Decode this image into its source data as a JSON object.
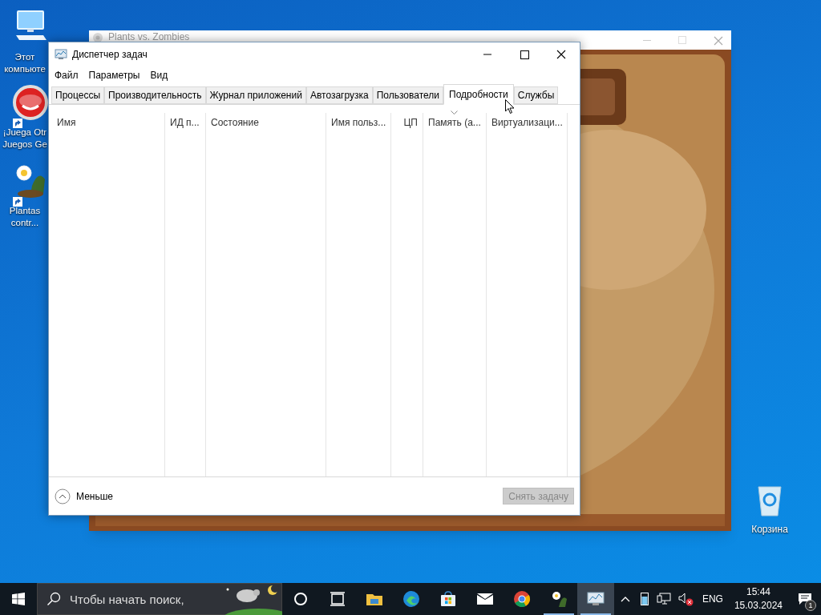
{
  "desktop_icons": [
    {
      "kind": "computer",
      "label": "Этот компьюте",
      "shortcut": false
    },
    {
      "kind": "popcap",
      "label": "¡Juega Otr Juegos Ge",
      "shortcut": true
    },
    {
      "kind": "plant",
      "label": "Plantas contr...",
      "shortcut": true
    },
    {
      "kind": "bin",
      "label": "Корзина",
      "shortcut": false
    }
  ],
  "game_window": {
    "title": "Plants vs. Zombies"
  },
  "task_manager": {
    "title": "Диспетчер задач",
    "menu": [
      "Файл",
      "Параметры",
      "Вид"
    ],
    "tabs": [
      {
        "label": "Процессы",
        "selected": false
      },
      {
        "label": "Производительность",
        "selected": false
      },
      {
        "label": "Журнал приложений",
        "selected": false
      },
      {
        "label": "Автозагрузка",
        "selected": false
      },
      {
        "label": "Пользователи",
        "selected": false
      },
      {
        "label": "Подробности",
        "selected": true
      },
      {
        "label": "Службы",
        "selected": false
      }
    ],
    "columns": [
      {
        "label": "Имя",
        "kind": "text",
        "sorted": false
      },
      {
        "label": "ИД п...",
        "kind": "text",
        "sorted": false
      },
      {
        "label": "Состояние",
        "kind": "text",
        "sorted": false
      },
      {
        "label": "Имя польз...",
        "kind": "text",
        "sorted": false
      },
      {
        "label": "ЦП",
        "kind": "number",
        "sorted": false
      },
      {
        "label": "Память (а...",
        "kind": "text",
        "sorted": true
      },
      {
        "label": "Виртуализаци...",
        "kind": "text",
        "sorted": false
      }
    ],
    "less_label": "Меньше",
    "end_task": {
      "label": "Снять задачу",
      "disabled": true
    }
  },
  "taskbar": {
    "search_placeholder": "Чтобы начать поиск,",
    "apps": [
      {
        "kind": "cortana",
        "selected": false,
        "running": false
      },
      {
        "kind": "taskview",
        "selected": false,
        "running": false
      },
      {
        "kind": "explorer",
        "selected": false,
        "running": false
      },
      {
        "kind": "edge",
        "selected": false,
        "running": false
      },
      {
        "kind": "store",
        "selected": false,
        "running": false
      },
      {
        "kind": "mail",
        "selected": false,
        "running": false
      },
      {
        "kind": "chrome",
        "selected": false,
        "running": false
      },
      {
        "kind": "plant",
        "selected": false,
        "running": true
      },
      {
        "kind": "taskmgr",
        "selected": true,
        "running": true
      }
    ],
    "language": "ENG",
    "time": "15:44",
    "date": "15.03.2024",
    "notifications": "1"
  }
}
